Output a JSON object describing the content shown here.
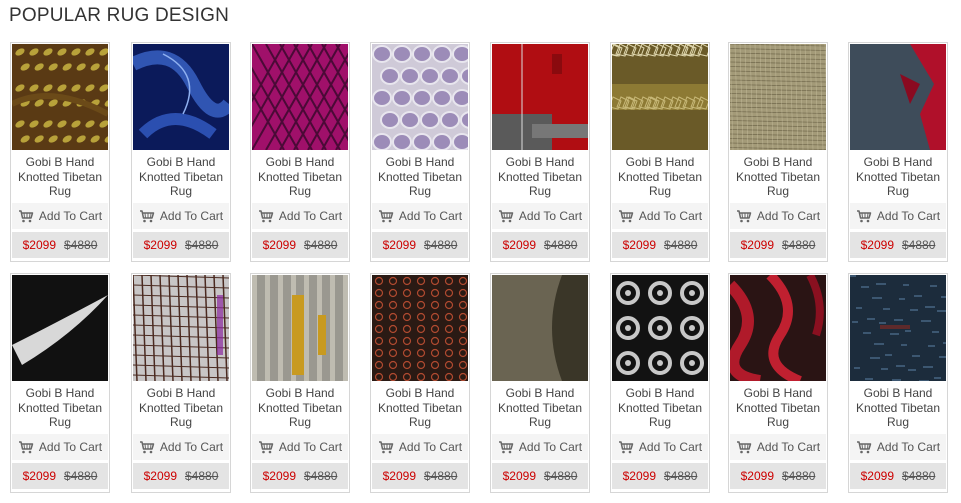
{
  "section": {
    "title": "POPULAR RUG DESIGN"
  },
  "colors": {
    "sale_price": "#cc0000",
    "card_border": "#d6d6d6",
    "cart_bg": "#f4f4f4",
    "price_bg": "#e4e4e4"
  },
  "products": [
    {
      "name": "Gobi B Hand Knotted Tibetan Rug",
      "cart_label": "Add To Cart",
      "price": "$2099",
      "old_price": "$4880",
      "image": "olive-brown-lattice-rug"
    },
    {
      "name": "Gobi B Hand Knotted Tibetan Rug",
      "cart_label": "Add To Cart",
      "price": "$2099",
      "old_price": "$4880",
      "image": "navy-blue-swirl-rug"
    },
    {
      "name": "Gobi B Hand Knotted Tibetan Rug",
      "cart_label": "Add To Cart",
      "price": "$2099",
      "old_price": "$4880",
      "image": "magenta-trellis-rug"
    },
    {
      "name": "Gobi B Hand Knotted Tibetan Rug",
      "cart_label": "Add To Cart",
      "price": "$2099",
      "old_price": "$4880",
      "image": "lavender-circles-rug"
    },
    {
      "name": "Gobi B Hand Knotted Tibetan Rug",
      "cart_label": "Add To Cart",
      "price": "$2099",
      "old_price": "$4880",
      "image": "red-grey-abstract-rug"
    },
    {
      "name": "Gobi B Hand Knotted Tibetan Rug",
      "cart_label": "Add To Cart",
      "price": "$2099",
      "old_price": "$4880",
      "image": "gold-crackle-rug"
    },
    {
      "name": "Gobi B Hand Knotted Tibetan Rug",
      "cart_label": "Add To Cart",
      "price": "$2099",
      "old_price": "$4880",
      "image": "beige-texture-rug"
    },
    {
      "name": "Gobi B Hand Knotted Tibetan Rug",
      "cart_label": "Add To Cart",
      "price": "$2099",
      "old_price": "$4880",
      "image": "slate-red-splash-rug"
    },
    {
      "name": "Gobi B Hand Knotted Tibetan Rug",
      "cart_label": "Add To Cart",
      "price": "$2099",
      "old_price": "$4880",
      "image": "black-white-stroke-rug"
    },
    {
      "name": "Gobi B Hand Knotted Tibetan Rug",
      "cart_label": "Add To Cart",
      "price": "$2099",
      "old_price": "$4880",
      "image": "grey-grid-rug"
    },
    {
      "name": "Gobi B Hand Knotted Tibetan Rug",
      "cart_label": "Add To Cart",
      "price": "$2099",
      "old_price": "$4880",
      "image": "grey-gold-stripes-rug"
    },
    {
      "name": "Gobi B Hand Knotted Tibetan Rug",
      "cart_label": "Add To Cart",
      "price": "$2099",
      "old_price": "$4880",
      "image": "brown-xo-pattern-rug"
    },
    {
      "name": "Gobi B Hand Knotted Tibetan Rug",
      "cart_label": "Add To Cart",
      "price": "$2099",
      "old_price": "$4880",
      "image": "khaki-arc-rug"
    },
    {
      "name": "Gobi B Hand Knotted Tibetan Rug",
      "cart_label": "Add To Cart",
      "price": "$2099",
      "old_price": "$4880",
      "image": "black-silver-floral-rug"
    },
    {
      "name": "Gobi B Hand Knotted Tibetan Rug",
      "cart_label": "Add To Cart",
      "price": "$2099",
      "old_price": "$4880",
      "image": "crimson-wave-rug"
    },
    {
      "name": "Gobi B Hand Knotted Tibetan Rug",
      "cart_label": "Add To Cart",
      "price": "$2099",
      "old_price": "$4880",
      "image": "dark-blue-distressed-rug"
    }
  ]
}
